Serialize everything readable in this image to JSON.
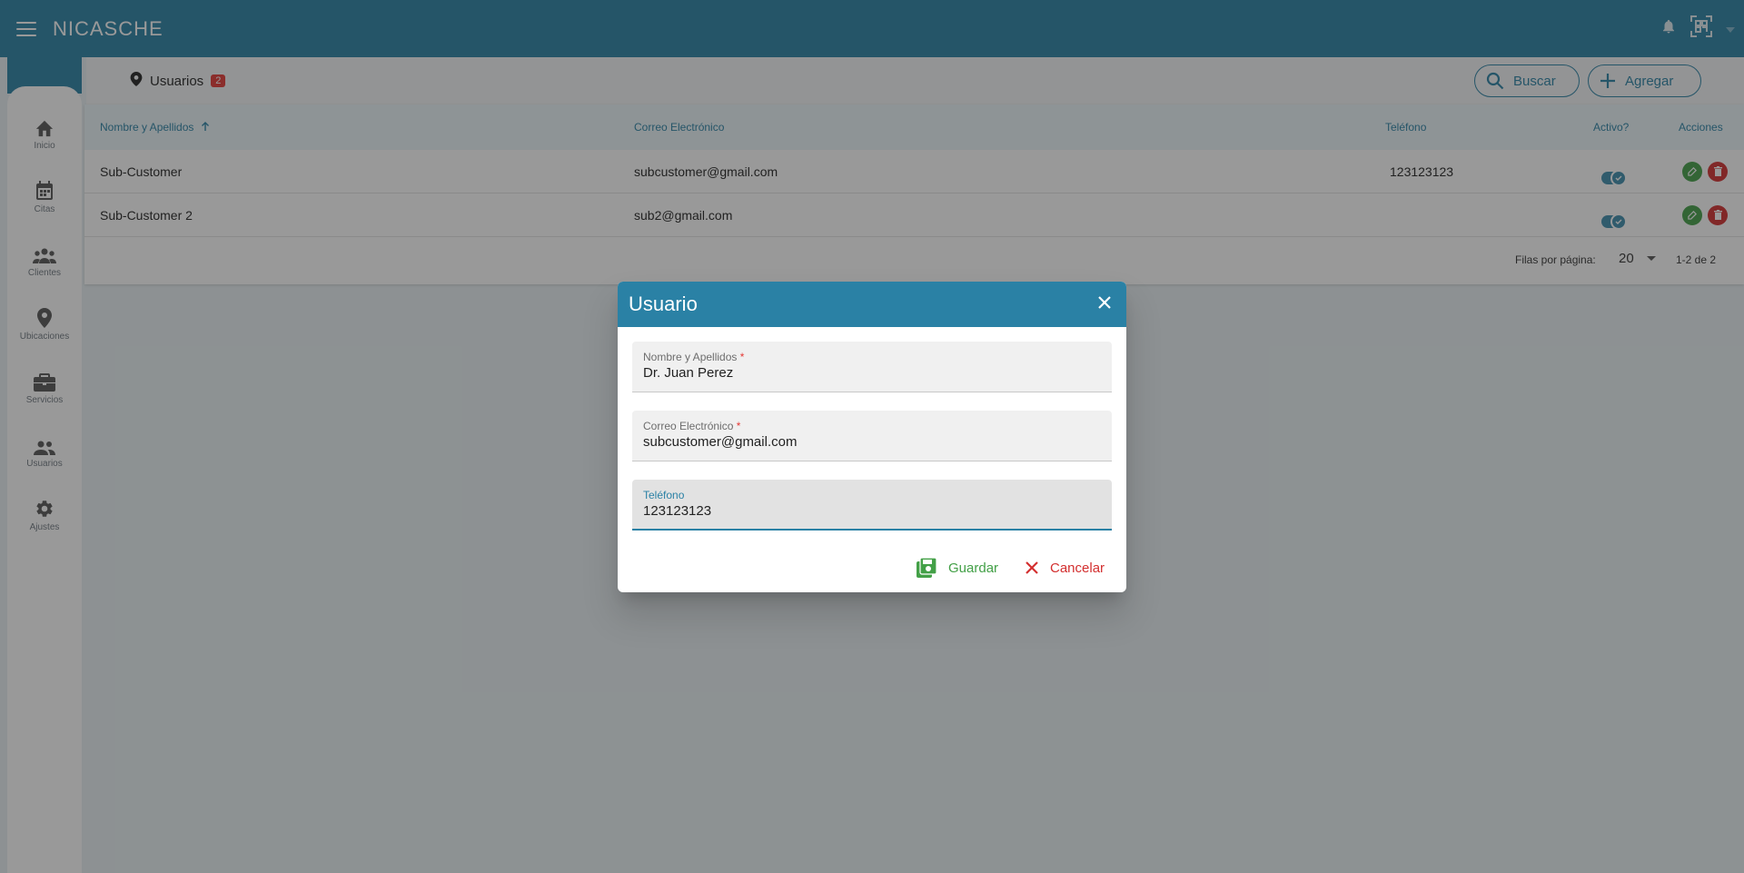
{
  "app": {
    "title": "NICASCHE"
  },
  "sidebar": {
    "items": [
      {
        "label": "Inicio",
        "icon": "home-icon"
      },
      {
        "label": "Citas",
        "icon": "calendar-icon"
      },
      {
        "label": "Clientes",
        "icon": "people-icon"
      },
      {
        "label": "Ubicaciones",
        "icon": "map-pin-icon"
      },
      {
        "label": "Servicios",
        "icon": "briefcase-icon"
      },
      {
        "label": "Usuarios",
        "icon": "users-icon"
      },
      {
        "label": "Ajustes",
        "icon": "gear-icon"
      }
    ]
  },
  "header": {
    "title": "Usuarios",
    "count": "2",
    "search_label": "Buscar",
    "add_label": "Agregar"
  },
  "table": {
    "columns": {
      "name": "Nombre y Apellidos",
      "email": "Correo Electrónico",
      "phone": "Teléfono",
      "active": "Activo?",
      "actions": "Acciones"
    },
    "rows": [
      {
        "name": "Sub-Customer",
        "email": "subcustomer@gmail.com",
        "phone": "123123123",
        "active": true
      },
      {
        "name": "Sub-Customer 2",
        "email": "sub2@gmail.com",
        "phone": "",
        "active": true
      }
    ],
    "footer": {
      "rows_per_page_label": "Filas por página:",
      "rows_per_page": "20",
      "range": "1-2 de 2"
    }
  },
  "dialog": {
    "title": "Usuario",
    "fields": {
      "name": {
        "label": "Nombre y Apellidos",
        "required_mark": "*",
        "value": "Dr. Juan Perez"
      },
      "email": {
        "label": "Correo Electrónico",
        "required_mark": "*",
        "value": "subcustomer@gmail.com"
      },
      "phone": {
        "label": "Teléfono",
        "value": "123123123"
      }
    },
    "save_label": "Guardar",
    "cancel_label": "Cancelar"
  },
  "colors": {
    "primary": "#2a81a5",
    "success": "#43a047",
    "danger": "#d32f2f",
    "badge": "#e53935"
  }
}
